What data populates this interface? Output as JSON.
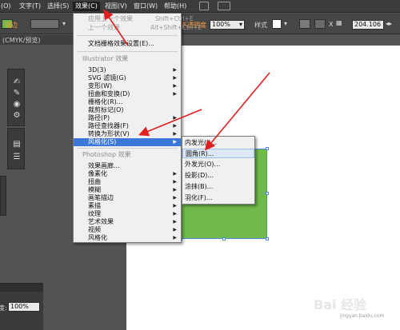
{
  "menubar": {
    "items": [
      "(O)",
      "文字(T)",
      "选择(S)",
      "效果(C)",
      "视图(V)",
      "窗口(W)",
      "帮助(H)"
    ],
    "active_index": 3
  },
  "controlbar": {
    "stroke_label": "描边",
    "opacity_label": "不透明度",
    "opacity_value": "100%",
    "style_label": "样式",
    "width_value": "204.106"
  },
  "document_tab": "(CMYK/预览)",
  "effect_menu": {
    "apply_last": "应用上一个效果",
    "apply_last_shortcut": "Shift+Ctrl+E",
    "last_effect": "上一个效果",
    "last_effect_shortcut": "Alt+Shift+Ctrl+E",
    "raster_settings": "文档栅格效果设置(E)...",
    "illustrator_section": "Illustrator 效果",
    "illustrator_items": [
      "3D(3)",
      "SVG 滤镜(G)",
      "变形(W)",
      "扭曲和变换(D)",
      "栅格化(R)...",
      "裁剪标记(O)",
      "路径(P)",
      "路径查找器(F)",
      "转换为形状(V)",
      "风格化(S)"
    ],
    "photoshop_section": "Photoshop 效果",
    "photoshop_items": [
      "效果画廊...",
      "像素化",
      "扭曲",
      "模糊",
      "画笔描边",
      "素描",
      "纹理",
      "艺术效果",
      "视频",
      "风格化"
    ],
    "highlighted": "风格化(S)"
  },
  "stylize_submenu": {
    "items": [
      "内发光(I)...",
      "圆角(R)...",
      "外发光(O)...",
      "投影(D)...",
      "涂抹(B)...",
      "羽化(F)..."
    ],
    "highlighted": "圆角(R)..."
  },
  "bottom_panel": {
    "label": "度:",
    "value": "100%"
  },
  "watermark": {
    "text": "Bai 经验",
    "sub": "jingyan.baidu.com"
  },
  "colors": {
    "accent": "#3b78d8",
    "arrow": "#e02020",
    "shape_fill": "#6fba4a"
  }
}
